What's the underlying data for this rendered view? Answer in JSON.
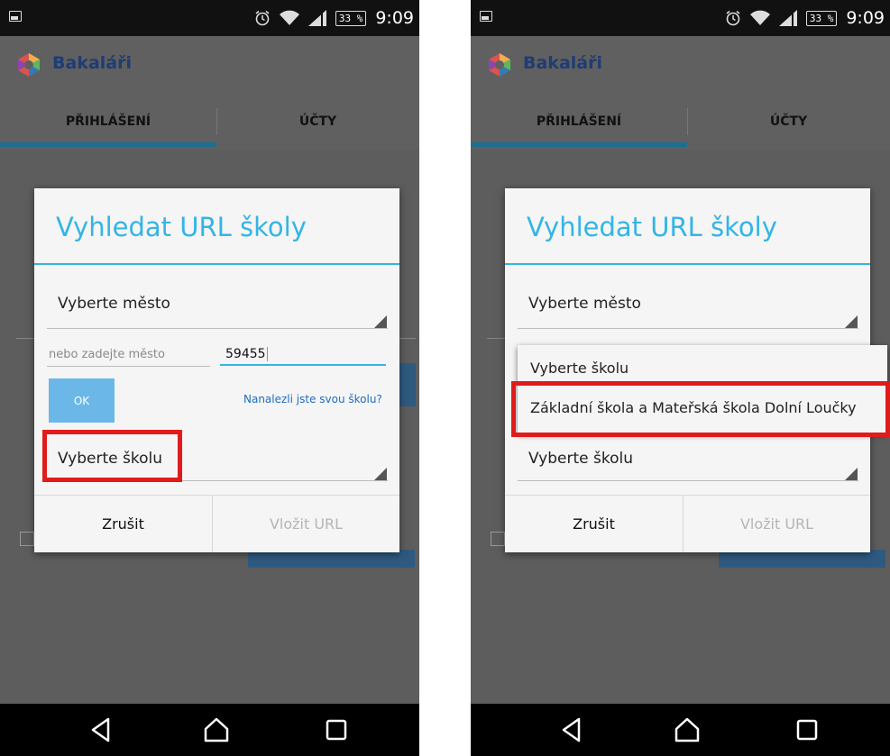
{
  "phones": [
    {
      "status": {
        "battery": "33 %",
        "time": "9:09"
      },
      "app_title": "Bakaláři",
      "tabs": [
        "PŘIHLÁŠENÍ",
        "ÚČTY"
      ],
      "dialog": {
        "title": "Vyhledat URL školy",
        "city_spinner": "Vyberte město",
        "city_input_hint": "nebo zadejte město",
        "zip_input_value": "59455",
        "ok_label": "OK",
        "found_link": "Nanalezli jste svou školu?",
        "school_spinner": "Vyberte školu",
        "cancel_label": "Zrušit",
        "insert_label": "Vložit URL"
      }
    },
    {
      "status": {
        "battery": "33 %",
        "time": "9:09"
      },
      "app_title": "Bakaláři",
      "tabs": [
        "PŘIHLÁŠENÍ",
        "ÚČTY"
      ],
      "dialog": {
        "title": "Vyhledat URL školy",
        "city_spinner": "Vyberte město",
        "school_spinner": "Vyberte školu",
        "cancel_label": "Zrušit",
        "insert_label": "Vložit URL"
      },
      "dropdown": {
        "items": [
          "Vyberte školu",
          "Základní škola a Mateřská škola Dolní Loučky"
        ]
      }
    }
  ],
  "colors": {
    "accent": "#33b5e5",
    "tab_indicator": "#1e6e93",
    "highlight": "#e11b1b",
    "brand": "#1f3c73"
  },
  "icons": [
    "image-icon",
    "alarm-icon",
    "wifi-icon",
    "signal-icon",
    "battery-icon",
    "bakalari-logo-icon",
    "spinner-arrow-icon",
    "back-icon",
    "home-icon",
    "recents-icon"
  ]
}
